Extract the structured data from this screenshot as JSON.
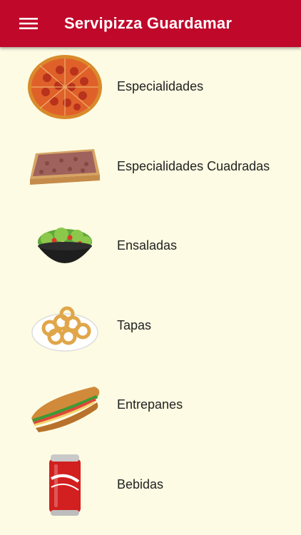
{
  "app": {
    "title": "Servipizza Guardamar"
  },
  "colors": {
    "appbar": "#c0082b",
    "background": "#fdfbe3",
    "text": "#222222"
  },
  "header": {
    "menu_icon": "hamburger-menu-icon"
  },
  "menu": {
    "items": [
      {
        "label": "Especialidades",
        "icon": "pizza-icon"
      },
      {
        "label": "Especialidades Cuadradas",
        "icon": "square-pizza-icon"
      },
      {
        "label": "Ensaladas",
        "icon": "salad-icon"
      },
      {
        "label": "Tapas",
        "icon": "tapas-icon"
      },
      {
        "label": "Entrepanes",
        "icon": "sandwich-icon"
      },
      {
        "label": "Bebidas",
        "icon": "cola-can-icon"
      }
    ]
  }
}
